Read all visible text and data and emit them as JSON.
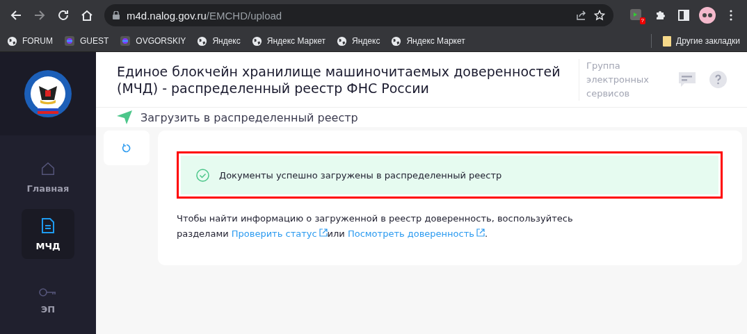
{
  "browser": {
    "url_host": "m4d.nalog.gov.ru",
    "url_path": "/EMCHD/upload",
    "extension_badge": "?",
    "bookmarks": [
      {
        "label": "FORUM",
        "kind": "globe"
      },
      {
        "label": "GUEST",
        "kind": "app"
      },
      {
        "label": "OVGORSKIY",
        "kind": "app"
      },
      {
        "label": "Яндекс",
        "kind": "globe"
      },
      {
        "label": "Яндекс Маркет",
        "kind": "globe"
      },
      {
        "label": "Яндекс",
        "kind": "globe"
      },
      {
        "label": "Яндекс Маркет",
        "kind": "globe"
      }
    ],
    "other_bookmarks": "Другие закладки"
  },
  "sidebar": {
    "items": [
      {
        "label": "Главная",
        "selected": false
      },
      {
        "label": "МЧД",
        "selected": true
      },
      {
        "label": "ЭП",
        "selected": false
      }
    ]
  },
  "header": {
    "title": "Единое блокчейн хранилище машиночитаемых доверенностей (МЧД) - распределенный реестр ФНС России",
    "group": "Группа электронных сервисов"
  },
  "page_title": "Загрузить в распределенный реестр",
  "alert": {
    "text": "Документы успешно загружены в распределенный реестр"
  },
  "message": [
    {
      "kind": "text",
      "text": "Чтобы найти информацию о загруженной в реестр доверенность, воспользуйтесь разделами "
    },
    {
      "kind": "link",
      "text": "Проверить статус"
    },
    {
      "kind": "text",
      "text": "или "
    },
    {
      "kind": "link",
      "text": "Посмотреть доверенность"
    },
    {
      "kind": "text",
      "text": "."
    }
  ]
}
